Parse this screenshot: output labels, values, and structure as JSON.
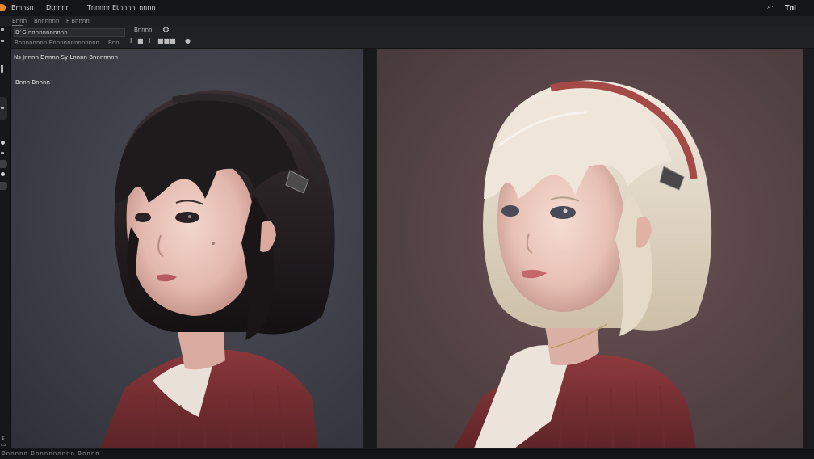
{
  "app": {
    "menu": [
      {
        "label": "Bmnsn"
      },
      {
        "label": "Dtnnnn"
      },
      {
        "label": "Tnnnnr Etnnnnl nnnn"
      }
    ],
    "titlebar_right": {
      "icon_label": "⌕·",
      "text": "Tnl"
    }
  },
  "tabs": [
    {
      "label": "Bnnn"
    },
    {
      "label": "Bnnnnnn"
    },
    {
      "label": "F Bnnnn"
    }
  ],
  "options": {
    "field1_label": "B⁄ G nnnnnnnnnnn",
    "field2_label": "Bnnnnnnnn Bnnnnnnnnnnnnn",
    "field3_label": "Bnn",
    "mode_label": "Bnnnn",
    "small_items": [
      "I",
      "■",
      "I",
      "■■■",
      "●"
    ]
  },
  "canvas": {
    "info_line_1": "Ns Jnnnn Dnnnn Sy Lnnnn Bnnnnnnn",
    "info_line_2": "Bnnn Bnnnn"
  },
  "statusbar": {
    "text": "Bnnnnn Bnnnnnnnnn Bnnnn"
  },
  "colors": {
    "accent": "#e8892b",
    "canvas_left_bg": "#44454d",
    "canvas_right_bg": "#5a4648",
    "sweater": "#7a2f33",
    "hair_dark": "#1e1a1c",
    "hair_light": "#e8dccb",
    "headband_red": "#a14a46"
  },
  "images": {
    "left": {
      "subject": "girl with dark bob haircut, headband, red sweater"
    },
    "right": {
      "subject": "girl with platinum blonde bob haircut, red headband, red sweater"
    }
  }
}
